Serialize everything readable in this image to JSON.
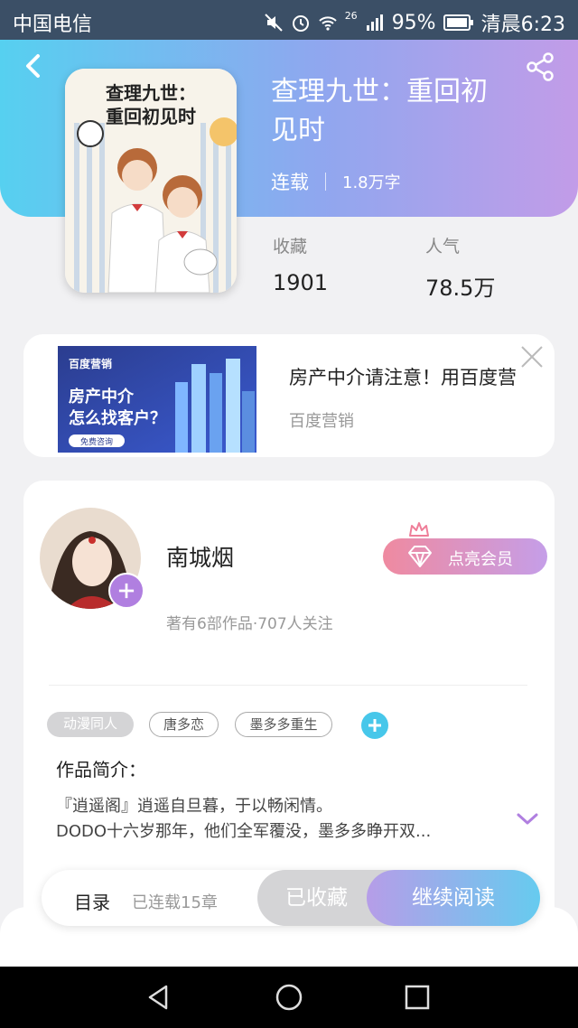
{
  "status_bar": {
    "carrier": "中国电信",
    "signal_label": "26",
    "battery": "95%",
    "time": "清晨6:23"
  },
  "book": {
    "title_line1": "查理九世：重回初",
    "title_line2": "见时",
    "status": "连载",
    "word_count": "1.8万字",
    "cover_text_line1": "查理九世：",
    "cover_text_line2": "重回初见时",
    "favorites_label": "收藏",
    "favorites_value": "1901",
    "popularity_label": "人气",
    "popularity_value": "78.5万"
  },
  "ad": {
    "image_brand": "百度营销",
    "image_line1": "房产中介",
    "image_line2": "怎么找客户？",
    "image_button": "免费咨询",
    "title": "房产中介请注意！用百度营",
    "source": "百度营销"
  },
  "author": {
    "name": "南城烟",
    "stats": "著有6部作品·707人关注",
    "vip_button": "点亮会员"
  },
  "tags": [
    "动漫同人",
    "唐多恋",
    "墨多多重生"
  ],
  "intro": {
    "title": "作品简介：",
    "line1": "『逍遥阁』逍遥自旦暮，于以畅闲情。",
    "line2": "DODO十六岁那年，他们全军覆没，墨多多睁开双..."
  },
  "bottom_bar": {
    "toc": "目录",
    "chapters": "已连载15章",
    "favorited": "已收藏",
    "continue_reading": "继续阅读"
  },
  "colors": {
    "header_gradient_start": "#56d0f0",
    "header_gradient_end": "#c29ce8",
    "accent_purple": "#b07fe0",
    "accent_cyan": "#47c7ea",
    "status_bar": "#3b4f66"
  },
  "icons": [
    "back-icon",
    "share-icon",
    "close-icon",
    "plus-icon",
    "diamond-icon",
    "crown-icon",
    "chevron-down-icon",
    "nav-back-icon",
    "nav-home-icon",
    "nav-recents-icon"
  ]
}
